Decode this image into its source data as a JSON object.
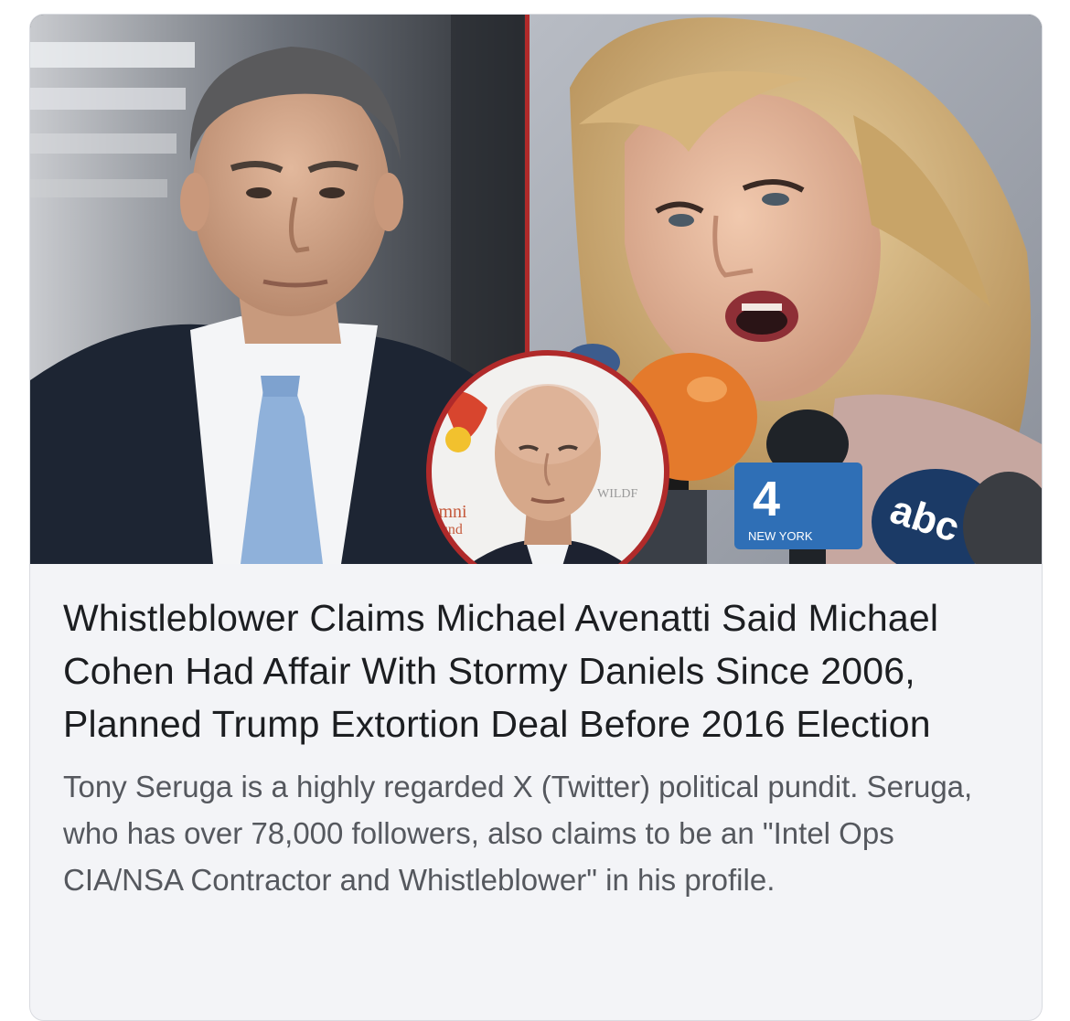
{
  "link_preview": {
    "headline": "Whistleblower Claims Michael Avenatti Said Michael Cohen Had Affair With Stormy Daniels Since 2006, Planned Trump Extortion Deal Before 2016 Election",
    "description": "Tony Seruga is a highly regarded X (Twitter) political pundit. Seruga, who has over 78,000 followers, also claims to be an \"Intel Ops CIA/NSA Contractor and Whistleblower\" in his profile.",
    "image": {
      "panels": [
        "man-in-suit-photo",
        "woman-at-microphones-photo",
        "bald-man-inset-photo"
      ],
      "inset_backdrop_text": [
        "Omni",
        "Found",
        "WILDF"
      ],
      "mic_flag_text": [
        "4",
        "NEW YORK",
        "abc"
      ]
    }
  },
  "colors": {
    "divider": "#b02a2a",
    "card_bg": "#f3f4f7",
    "headline": "#1c1e21",
    "description": "#55585e"
  }
}
